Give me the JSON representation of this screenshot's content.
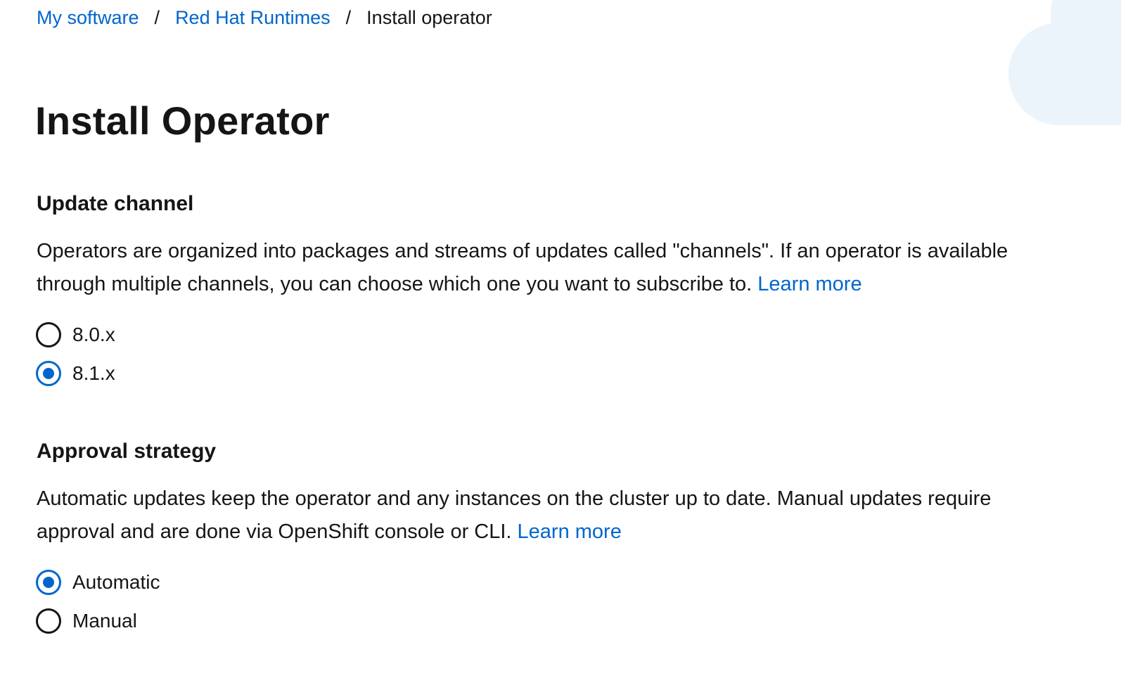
{
  "breadcrumb": {
    "items": [
      {
        "label": "My software",
        "link": true
      },
      {
        "label": "Red Hat Runtimes",
        "link": true
      },
      {
        "label": "Install operator",
        "link": false
      }
    ],
    "separator": "/"
  },
  "page": {
    "title": "Install Operator"
  },
  "update_channel": {
    "heading": "Update channel",
    "description": "Operators are organized into packages and streams of updates called \"channels\". If an operator is available through multiple channels, you can choose which one you want to subscribe to.",
    "learn_more": "Learn more",
    "options": [
      {
        "label": "8.0.x",
        "checked": false
      },
      {
        "label": "8.1.x",
        "checked": true
      }
    ]
  },
  "approval_strategy": {
    "heading": "Approval strategy",
    "description": "Automatic updates keep the operator and any instances on the cluster up to date. Manual updates require approval and are done via OpenShift console or CLI.",
    "learn_more": "Learn more",
    "options": [
      {
        "label": "Automatic",
        "checked": true
      },
      {
        "label": "Manual",
        "checked": false
      }
    ]
  },
  "colors": {
    "link": "#0066cc",
    "text": "#151515",
    "radio_selected": "#0066cc",
    "cloud": "#ebf4fa"
  }
}
